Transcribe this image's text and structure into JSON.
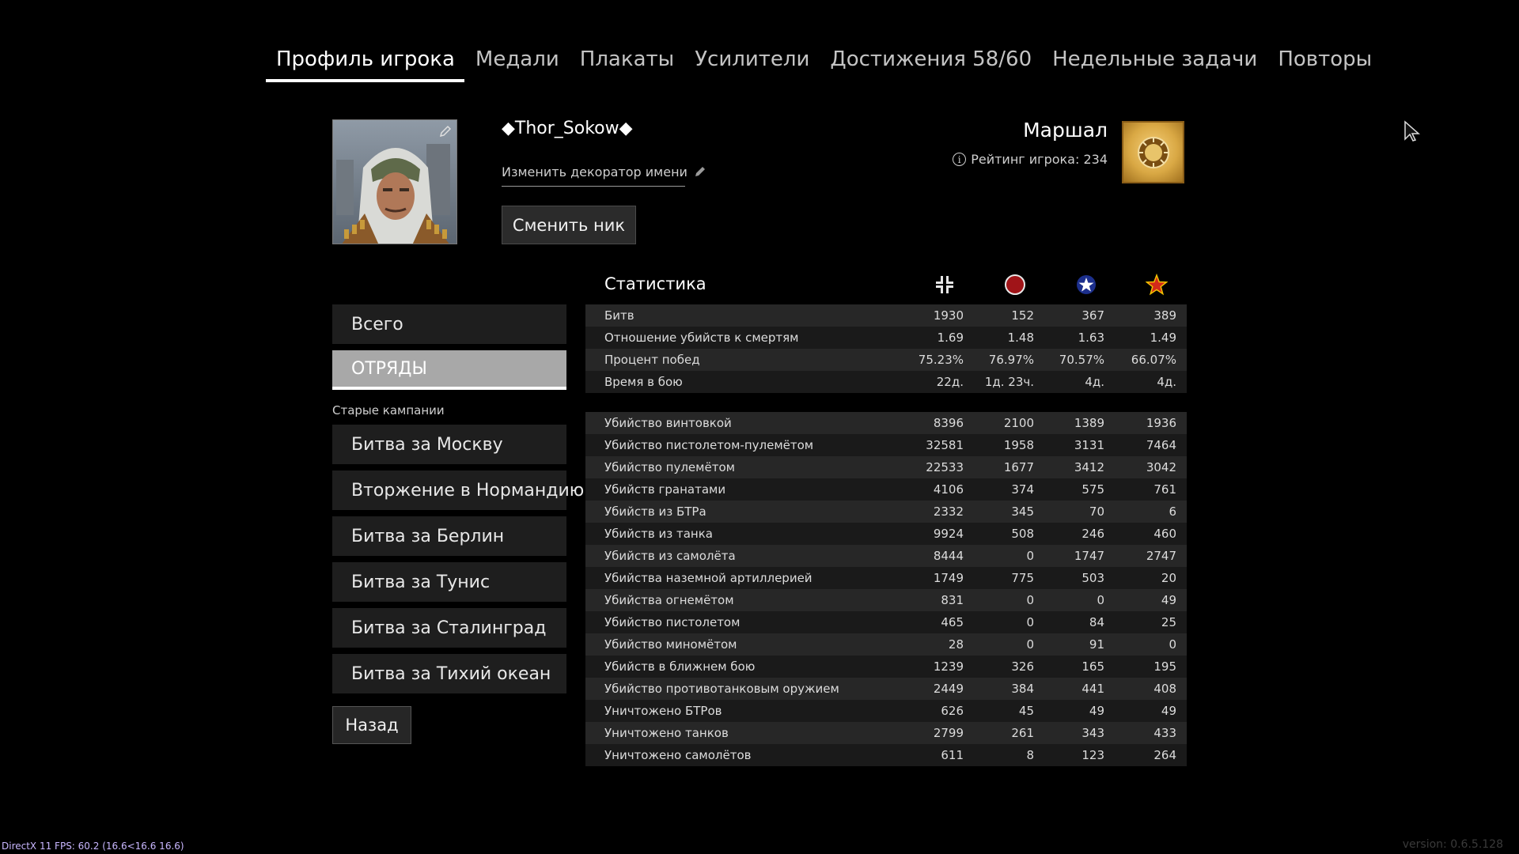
{
  "tabs": [
    {
      "label": "Профиль игрока"
    },
    {
      "label": "Медали"
    },
    {
      "label": "Плакаты"
    },
    {
      "label": "Усилители"
    },
    {
      "label": "Достижения 58/60"
    },
    {
      "label": "Недельные задачи"
    },
    {
      "label": "Повторы"
    }
  ],
  "profile": {
    "nickname": "◆Thor_Sokow◆",
    "decorator_link": "Изменить декоратор имени",
    "change_nick_button": "Сменить ник",
    "rank": "Маршал",
    "rating": "Рейтинг игрока: 234",
    "info_icon": "i"
  },
  "menu": {
    "total": "Всего",
    "squads": "ОТРЯДЫ",
    "old_campaigns_caption": "Старые кампании",
    "campaigns": [
      "Битва за Москву",
      "Вторжение в Нормандию",
      "Битва за Берлин",
      "Битва за Тунис",
      "Битва за Сталинград",
      "Битва за Тихий океан"
    ],
    "back": "Назад"
  },
  "stats": {
    "title": "Статистика",
    "columns": [
      "axis-cross-icon",
      "red-circle-icon",
      "blue-star-icon",
      "red-star-icon"
    ],
    "colors": {
      "red_circle": "#a01418",
      "blue_star": "#1c2f8c",
      "red_star": "#d32a1a",
      "star_outline": "#f2c200"
    },
    "general": [
      {
        "label": "Битв",
        "values": [
          "1930",
          "152",
          "367",
          "389"
        ]
      },
      {
        "label": "Отношение убийств к смертям",
        "values": [
          "1.69",
          "1.48",
          "1.63",
          "1.49"
        ]
      },
      {
        "label": "Процент побед",
        "values": [
          "75.23%",
          "76.97%",
          "70.57%",
          "66.07%"
        ]
      },
      {
        "label": "Время в бою",
        "values": [
          "22д.",
          "1д. 23ч.",
          "4д.",
          "4д."
        ]
      }
    ],
    "kills": [
      {
        "label": "Убийство винтовкой",
        "values": [
          "8396",
          "2100",
          "1389",
          "1936"
        ]
      },
      {
        "label": "Убийство пистолетом-пулемётом",
        "values": [
          "32581",
          "1958",
          "3131",
          "7464"
        ]
      },
      {
        "label": "Убийство пулемётом",
        "values": [
          "22533",
          "1677",
          "3412",
          "3042"
        ]
      },
      {
        "label": "Убийств гранатами",
        "values": [
          "4106",
          "374",
          "575",
          "761"
        ]
      },
      {
        "label": "Убийств из БТРа",
        "values": [
          "2332",
          "345",
          "70",
          "6"
        ]
      },
      {
        "label": "Убийств из танка",
        "values": [
          "9924",
          "508",
          "246",
          "460"
        ]
      },
      {
        "label": "Убийств из самолёта",
        "values": [
          "8444",
          "0",
          "1747",
          "2747"
        ]
      },
      {
        "label": "Убийства наземной артиллерией",
        "values": [
          "1749",
          "775",
          "503",
          "20"
        ]
      },
      {
        "label": "Убийства огнемётом",
        "values": [
          "831",
          "0",
          "0",
          "49"
        ]
      },
      {
        "label": "Убийство пистолетом",
        "values": [
          "465",
          "0",
          "84",
          "25"
        ]
      },
      {
        "label": "Убийство миномётом",
        "values": [
          "28",
          "0",
          "91",
          "0"
        ]
      },
      {
        "label": "Убийств в ближнем бою",
        "values": [
          "1239",
          "326",
          "165",
          "195"
        ]
      },
      {
        "label": "Убийство противотанковым оружием",
        "values": [
          "2449",
          "384",
          "441",
          "408"
        ]
      },
      {
        "label": "Уничтожено БТРов",
        "values": [
          "626",
          "45",
          "49",
          "49"
        ]
      },
      {
        "label": "Уничтожено танков",
        "values": [
          "2799",
          "261",
          "343",
          "433"
        ]
      },
      {
        "label": "Уничтожено самолётов",
        "values": [
          "611",
          "8",
          "123",
          "264"
        ]
      }
    ]
  },
  "footer": {
    "fps": "DirectX 11 FPS: 60.2 (16.6<16.6 16.6)",
    "version": "version: 0.6.5.128"
  }
}
